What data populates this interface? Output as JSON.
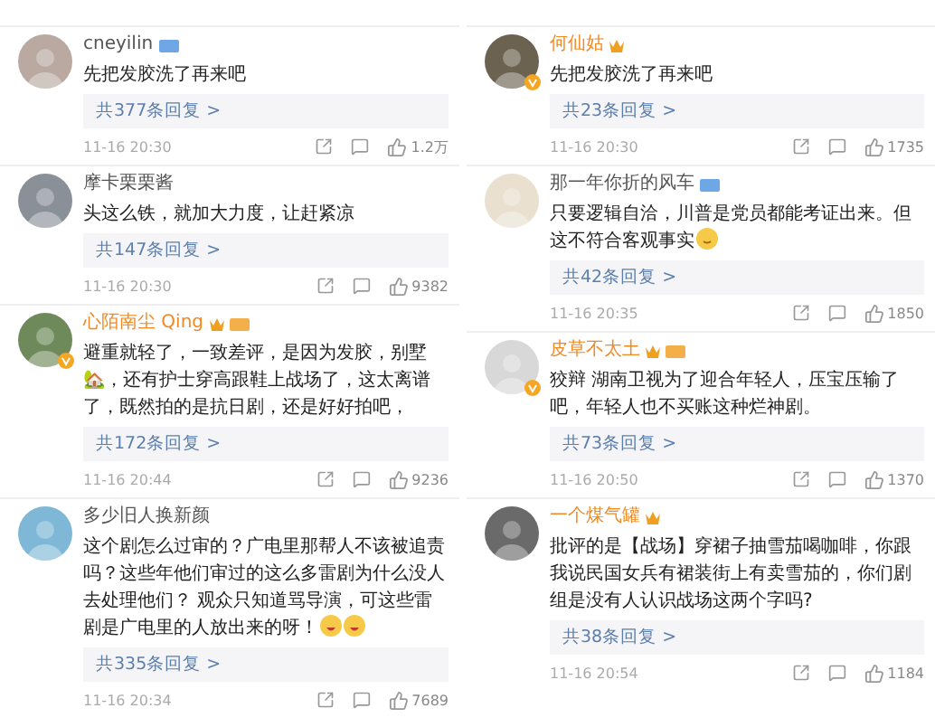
{
  "columns": [
    {
      "comments": [
        {
          "name": "cneyilin",
          "vip": false,
          "crown": false,
          "tag": true,
          "verified": false,
          "text": "先把发胶洗了再来吧",
          "replies": "共377条回复 >",
          "time": "11-16 20:30",
          "likes": "1.2万"
        },
        {
          "name": "摩卡栗栗酱",
          "vip": false,
          "crown": false,
          "tag": false,
          "verified": false,
          "text": "头这么铁，就加大力度，让赶紧凉",
          "replies": "共147条回复 >",
          "time": "11-16 20:30",
          "likes": "9382"
        },
        {
          "name": "心陌南尘 Qing",
          "vip": true,
          "crown": true,
          "tag": true,
          "verified": true,
          "text": "避重就轻了，一致差评，是因为发胶，别墅🏡，还有护士穿高跟鞋上战场了，这太离谱了，既然拍的是抗日剧，还是好好拍吧，",
          "replies": "共172条回复 >",
          "time": "11-16 20:44",
          "likes": "9236"
        },
        {
          "name": "多少旧人换新颜",
          "vip": false,
          "crown": false,
          "tag": false,
          "verified": false,
          "text": "这个剧怎么过审的？广电里那帮人不该被追责吗？这些年他们审过的这么多雷剧为什么没人去处理他们？ 观众只知道骂导演，可这些雷剧是广电里的人放出来的呀！",
          "emojis": [
            {
              "kind": "laugh"
            },
            {
              "kind": "laugh"
            }
          ],
          "replies": "共335条回复 >",
          "time": "11-16 20:34",
          "likes": "7689"
        }
      ]
    },
    {
      "comments": [
        {
          "name": "何仙姑",
          "vip": true,
          "crown": true,
          "tag": false,
          "verified": true,
          "text": "先把发胶洗了再来吧",
          "replies": "共23条回复 >",
          "time": "11-16 20:30",
          "likes": "1735"
        },
        {
          "name": "那一年你折的风车",
          "vip": false,
          "crown": false,
          "tag": true,
          "verified": false,
          "text": "只要逻辑自洽，川普是党员都能考证出来。但这不符合客观事实",
          "emojis": [
            {
              "kind": "smile"
            }
          ],
          "replies": "共42条回复 >",
          "time": "11-16 20:35",
          "likes": "1850"
        },
        {
          "name": "皮草不太土",
          "vip": true,
          "crown": true,
          "tag": true,
          "verified": true,
          "text": "狡辩  湖南卫视为了迎合年轻人，压宝压输了吧，年轻人也不买账这种烂神剧。",
          "replies": "共73条回复 >",
          "time": "11-16 20:50",
          "likes": "1370"
        },
        {
          "name": "一个煤气罐",
          "vip": true,
          "crown": true,
          "tag": false,
          "verified": false,
          "text": "批评的是【战场】穿裙子抽雪茄喝咖啡，你跟我说民国女兵有裙装街上有卖雪茄的，你们剧组是没有人认识战场这两个字吗?",
          "replies": "共38条回复 >",
          "time": "11-16 20:54",
          "likes": "1184"
        }
      ]
    }
  ]
}
